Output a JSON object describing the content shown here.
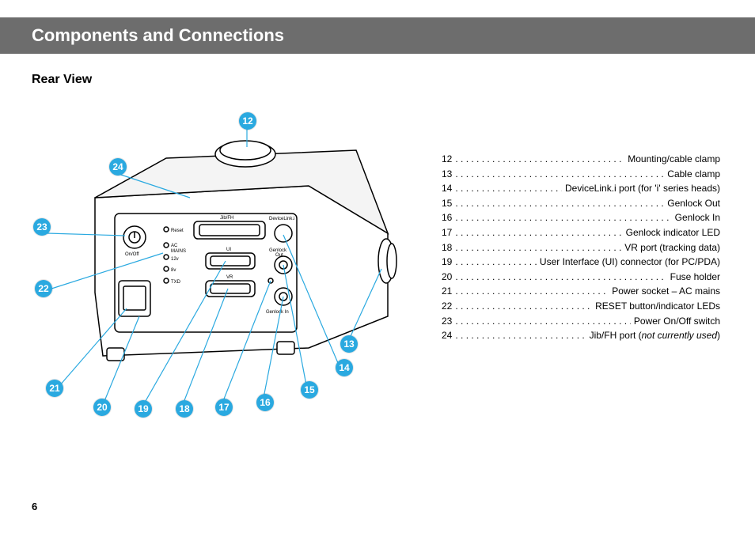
{
  "header": {
    "title": "Components and Connections"
  },
  "subheader": {
    "title": "Rear View"
  },
  "page_number": "6",
  "callouts": {
    "c12": "12",
    "c13": "13",
    "c14": "14",
    "c15": "15",
    "c16": "16",
    "c17": "17",
    "c18": "18",
    "c19": "19",
    "c20": "20",
    "c21": "21",
    "c22": "22",
    "c23": "23",
    "c24": "24"
  },
  "diagram_labels": {
    "onoff": "On/Off",
    "reset": "Reset",
    "ac_mains": "AC\nMAINS",
    "v12": "12v",
    "v8": "8v",
    "txd": "TXD",
    "jibfh": "Jib/FH",
    "ui": "UI",
    "vr": "VR",
    "devicelink": "DeviceLink.i",
    "genlock_out": "Genlock\nOut",
    "genlock_in_led": "Genlock In"
  },
  "legend": [
    {
      "num": "12",
      "desc": "Mounting/cable clamp"
    },
    {
      "num": "13",
      "desc": "Cable clamp"
    },
    {
      "num": "14",
      "desc": "DeviceLink.i port (for 'i' series heads)"
    },
    {
      "num": "15",
      "desc": "Genlock Out"
    },
    {
      "num": "16",
      "desc": "Genlock In"
    },
    {
      "num": "17",
      "desc": "Genlock indicator LED"
    },
    {
      "num": "18",
      "desc": "VR port (tracking data)"
    },
    {
      "num": "19",
      "desc": "User Interface (UI) connector (for PC/PDA)"
    },
    {
      "num": "20",
      "desc": "Fuse holder"
    },
    {
      "num": "21",
      "desc": "Power socket – AC mains"
    },
    {
      "num": "22",
      "desc": "RESET button/indicator LEDs"
    },
    {
      "num": "23",
      "desc": "Power On/Off switch"
    },
    {
      "num": "24",
      "desc_html": "Jib/FH port (<i>not currently used</i>)"
    }
  ]
}
